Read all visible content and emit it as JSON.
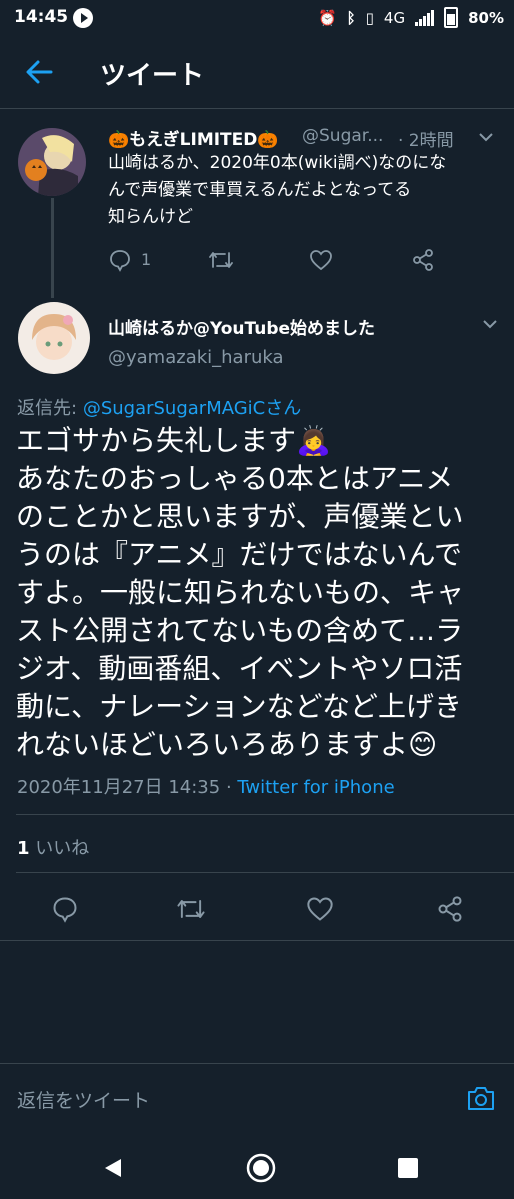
{
  "status_bar": {
    "time": "14:45",
    "network": "4G",
    "battery": "80%"
  },
  "header": {
    "title": "ツイート",
    "back_icon": "arrow-left-icon"
  },
  "parent_tweet": {
    "name": "🎃もえぎLIMITED🎃",
    "handle": "@Sugar...",
    "time": "· 2時間",
    "text_lines": [
      "山崎はるか、2020年0本(wiki調べ)なのにな",
      "んで声優業で車買えるんだよとなってる",
      "知らんけど"
    ],
    "reply_count": "1"
  },
  "main_tweet": {
    "name": "山崎はるか@YouTube始めました",
    "handle": "@yamazaki_haruka",
    "reply_to_label": "返信先:",
    "reply_to_handle": "@SugarSugarMAGiCさん",
    "text_lines": [
      "エゴサから失礼します🙇‍♀️",
      "あなたのおっしゃる0本とはアニメ",
      "のことかと思いますが、声優業とい",
      "うのは『アニメ』だけではないんで",
      "すよ。一般に知られないもの、キャ",
      "スト公開されてないもの含めて…ラ",
      "ジオ、動画番組、イベントやソロ活",
      "動に、ナレーションなどなど上げき",
      "れないほどいろいろありますよ😊"
    ],
    "timestamp": "2020年11月27日 14:35",
    "dot": " · ",
    "source": "Twitter for iPhone",
    "likes_count": "1",
    "likes_label": "いいね"
  },
  "reply_bar": {
    "placeholder": "返信をツイート"
  },
  "colors": {
    "background": "#15202b",
    "accent": "#1da1f2",
    "muted": "#8899a6",
    "border": "#38444d"
  }
}
